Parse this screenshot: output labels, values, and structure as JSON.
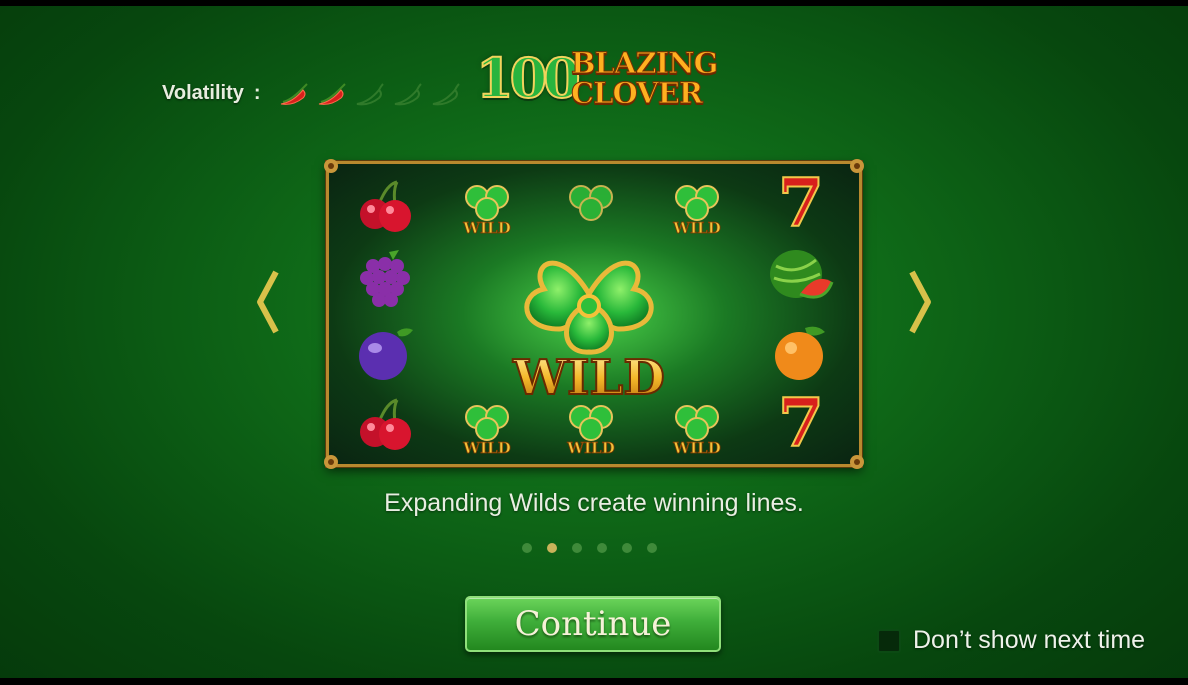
{
  "header": {
    "volatility_label": "Volatility",
    "volatility_colon": ":",
    "volatility_level": 2,
    "volatility_max": 5,
    "logo_number": "100",
    "logo_line1": "BLAZING",
    "logo_line2": "CLOVER"
  },
  "reels": {
    "wild_label": "WILD",
    "center_symbol": "clover-wild",
    "left_column": [
      "cherry",
      "grape",
      "plum",
      "cherry"
    ],
    "right_column": [
      "seven",
      "watermelon",
      "orange",
      "seven"
    ],
    "seven_label": "7"
  },
  "caption": "Expanding Wilds create winning lines.",
  "pagination": {
    "count": 6,
    "active_index": 1
  },
  "continue_label": "Continue",
  "dont_show_label": "Don’t show next time",
  "dont_show_checked": false,
  "colors": {
    "accent_gold": "#c9b35a",
    "button_green": "#3fae3a",
    "background_green": "#0f6a18"
  }
}
